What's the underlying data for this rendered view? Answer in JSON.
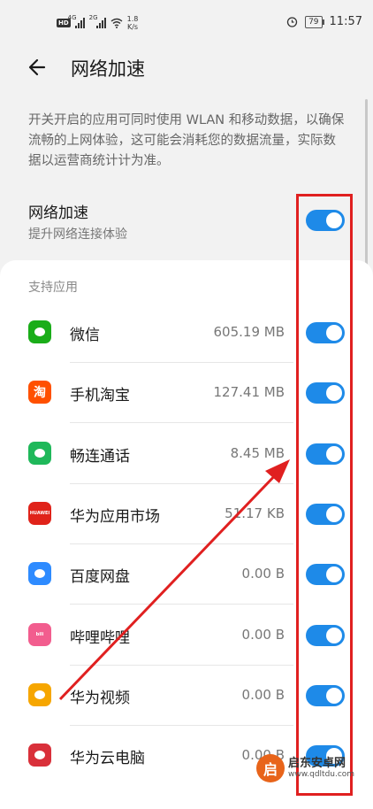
{
  "status": {
    "net_labels": [
      "4G",
      "2G"
    ],
    "speed_value": "1.8",
    "speed_unit": "K/s",
    "battery": "79",
    "time": "11:57"
  },
  "header": {
    "title": "网络加速"
  },
  "description": "开关开启的应用可同时使用 WLAN 和移动数据，以确保流畅的上网体验，这可能会消耗您的数据流量，实际数据以运营商统计计为准。",
  "master": {
    "title": "网络加速",
    "subtitle": "提升网络连接体验",
    "enabled": true
  },
  "section_label": "支持应用",
  "apps": [
    {
      "name": "微信",
      "size": "605.19 MB",
      "enabled": true,
      "icon": "wechat-icon",
      "color": "#1aad19"
    },
    {
      "name": "手机淘宝",
      "size": "127.41 MB",
      "enabled": true,
      "icon": "taobao-icon",
      "color": "#ff5000",
      "icon_text": "淘"
    },
    {
      "name": "畅连通话",
      "size": "8.45 MB",
      "enabled": true,
      "icon": "meetime-icon",
      "color": "#1fb85a"
    },
    {
      "name": "华为应用市场",
      "size": "51.17 KB",
      "enabled": true,
      "icon": "appgallery-icon",
      "color": "#e0231a",
      "icon_text": "HUAWEI"
    },
    {
      "name": "百度网盘",
      "size": "0.00 B",
      "enabled": true,
      "icon": "baidu-netdisk-icon",
      "color": "#2e8bff"
    },
    {
      "name": "哔哩哔哩",
      "size": "0.00 B",
      "enabled": true,
      "icon": "bilibili-icon",
      "color": "#f25d8e",
      "icon_text": "bili"
    },
    {
      "name": "华为视频",
      "size": "0.00 B",
      "enabled": true,
      "icon": "huawei-video-icon",
      "color": "#f6a600"
    },
    {
      "name": "华为云电脑",
      "size": "0.00 B",
      "enabled": true,
      "icon": "cloud-pc-icon",
      "color": "#d9303a"
    }
  ],
  "watermark": {
    "logo_text": "启",
    "line1": "启东安卓网",
    "line2": "www.qdltdu.com"
  },
  "colors": {
    "toggle_on": "#1e8ae8",
    "annotation": "#e02020"
  }
}
